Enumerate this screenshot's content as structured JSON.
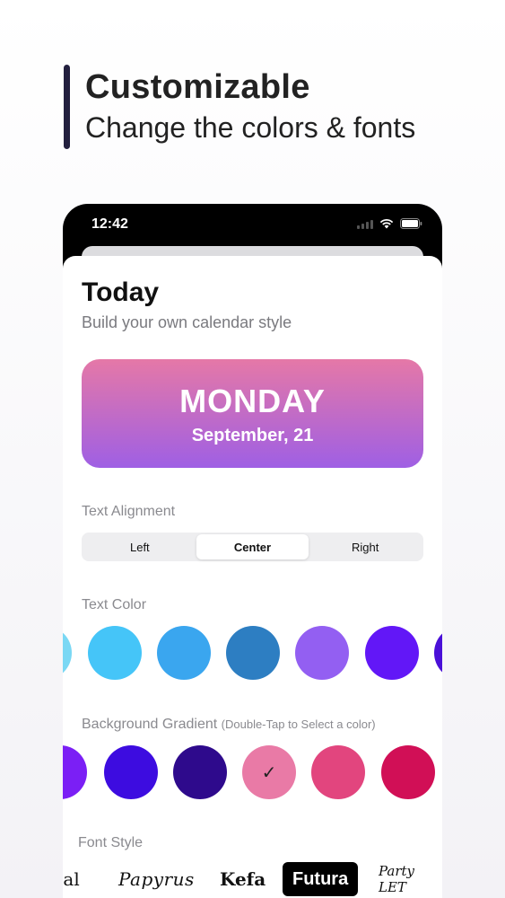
{
  "hero": {
    "title": "Customizable",
    "subtitle": "Change the colors & fonts"
  },
  "status_bar": {
    "time": "12:42",
    "icons": [
      "signal-icon",
      "wifi-icon",
      "battery-icon"
    ]
  },
  "sheet": {
    "title": "Today",
    "subtitle": "Build your own calendar style"
  },
  "preview": {
    "day": "MONDAY",
    "date": "September, 21",
    "gradient": [
      "#e578a7",
      "#9f5fe4"
    ]
  },
  "text_alignment": {
    "label": "Text Alignment",
    "options": [
      "Left",
      "Center",
      "Right"
    ],
    "selected": "Center"
  },
  "text_color": {
    "label": "Text Color",
    "swatches": [
      "#7ad8f4",
      "#45c5f8",
      "#3aa6ef",
      "#2d7ec2",
      "#935ff2",
      "#6217f7",
      "#4a10d8"
    ]
  },
  "background_gradient": {
    "label": "Background Gradient",
    "hint": "(Double-Tap to Select a color)",
    "swatches": [
      "#7b1ff5",
      "#3d0ce0",
      "#2e0a8c",
      "#e97aa6",
      "#e2457e",
      "#d10f56"
    ],
    "selected_index": 3,
    "check_glyph": "✓"
  },
  "font_style": {
    "label": "Font Style",
    "options": [
      "ial",
      "Papyrus",
      "Kefa",
      "Futura",
      "Party LET"
    ],
    "selected": "Futura"
  }
}
